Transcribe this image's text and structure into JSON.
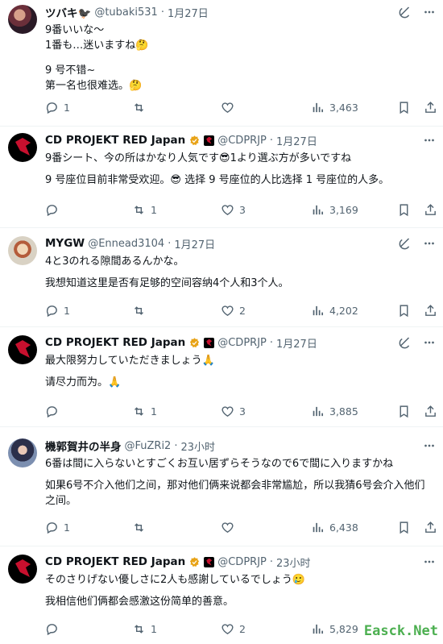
{
  "tweets": [
    {
      "name": "ツバキ🐦‍⬛",
      "handle": "@tubaki531",
      "date": "1月27日",
      "verified": false,
      "lines": [
        "9番いいな～",
        "1番も…迷いますね🤔",
        "",
        "9 号不错~",
        "第一名也很难选。🤔"
      ],
      "reply": "1",
      "retweet": "",
      "like": "",
      "views": "3,463"
    },
    {
      "name": "CD PROJEKT RED Japan",
      "handle": "@CDPRJP",
      "date": "1月27日",
      "verified": true,
      "lines": [
        "9番シート、今の所はかなり人気です😎1より選ぶ方が多いですね",
        "9 号座位目前非常受欢迎。😎 选择 9 号座位的人比选择 1 号座位的人多。"
      ],
      "reply": "",
      "retweet": "1",
      "like": "3",
      "views": "3,169"
    },
    {
      "name": "MYGW",
      "handle": "@Ennead3104",
      "date": "1月27日",
      "verified": false,
      "lines": [
        "4と3のれる隙間あるんかな。",
        "我想知道这里是否有足够的空间容纳4个人和3个人。"
      ],
      "reply": "1",
      "retweet": "",
      "like": "2",
      "views": "4,202"
    },
    {
      "name": "CD PROJEKT RED Japan",
      "handle": "@CDPRJP",
      "date": "1月27日",
      "verified": true,
      "lines": [
        "最大限努力していただきましょう🙏",
        "请尽力而为。🙏"
      ],
      "reply": "",
      "retweet": "1",
      "like": "3",
      "views": "3,885"
    },
    {
      "name": "機郭賀井の半身",
      "handle": "@FuZRi2",
      "date": "23小时",
      "verified": false,
      "lines": [
        "6番は間に入らないとすごくお互い居ずらそうなので6で間に入りますかね",
        "如果6号不介入他们之间，那对他们俩来说都会非常尴尬，所以我猜6号会介入他们之间。"
      ],
      "reply": "1",
      "retweet": "",
      "like": "",
      "views": "6,438"
    },
    {
      "name": "CD PROJEKT RED Japan",
      "handle": "@CDPRJP",
      "date": "23小时",
      "verified": true,
      "lines": [
        "そのさりげない優しさに2人も感謝しているでしょう🥲",
        "我相信他们俩都会感激这份简单的善意。"
      ],
      "reply": "",
      "retweet": "1",
      "like": "2",
      "views": "5,829"
    }
  ],
  "watermark": "Easck.Net",
  "colors": {
    "meta": "#536471",
    "text": "#0f1419",
    "verified": "#e8a317",
    "brand": "#c8102e"
  }
}
